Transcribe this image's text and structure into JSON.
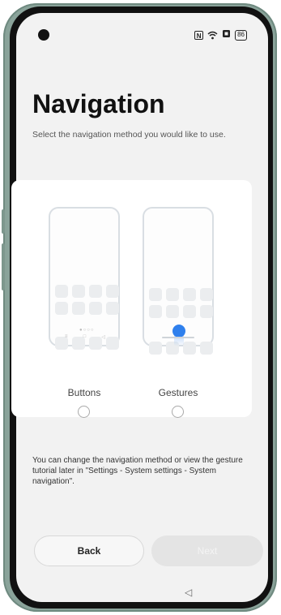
{
  "status_bar": {
    "nfc_glyph": "N",
    "battery_level": "86"
  },
  "page": {
    "title": "Navigation",
    "subtitle": "Select the navigation method you would like to use."
  },
  "options": [
    {
      "label": "Buttons",
      "selected": false
    },
    {
      "label": "Gestures",
      "selected": false
    }
  ],
  "help_text": "You can change the navigation method or view the gesture tutorial later in \"Settings - System settings - System navigation\".",
  "footer": {
    "back_label": "Back",
    "next_label": "Next"
  },
  "nav_bar": {
    "back_glyph": "◁"
  },
  "colors": {
    "accent": "#2f80ed",
    "screen_bg": "#f2f2f2",
    "card_bg": "#ffffff"
  }
}
